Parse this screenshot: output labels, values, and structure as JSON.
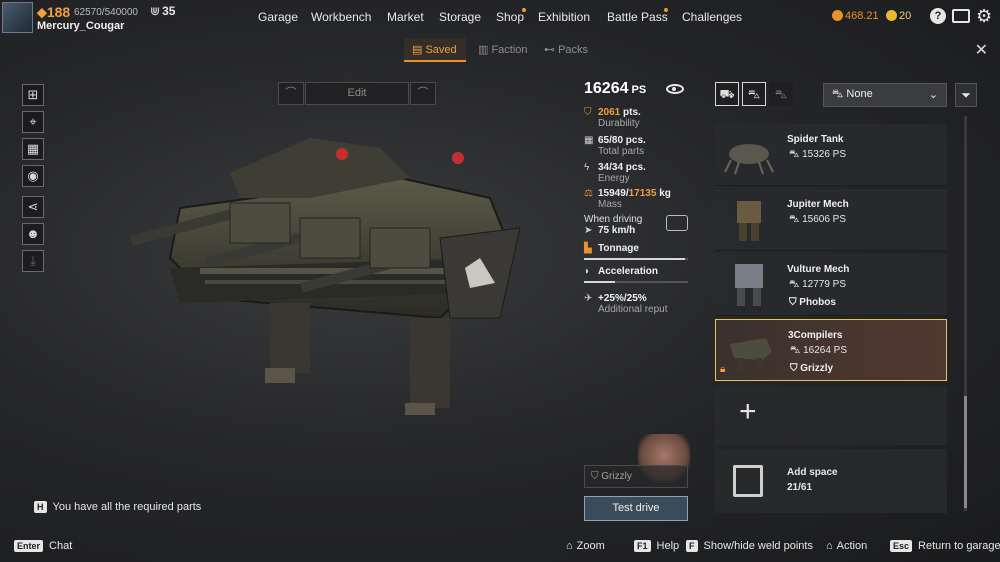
{
  "player": {
    "level": "188",
    "xp": "62570/540000",
    "rank": "35",
    "username": "Mercury_Cougar"
  },
  "nav": {
    "items": [
      "Garage",
      "Workbench",
      "Market",
      "Storage",
      "Shop",
      "Exhibition",
      "Battle Pass",
      "Challenges"
    ]
  },
  "currency": {
    "coins": "468.21",
    "coins_color": "#e8922e",
    "gold": "20",
    "gold_color": "#e8b830"
  },
  "top_icons": [
    "help-icon",
    "news-icon",
    "settings-icon"
  ],
  "subtabs": {
    "saved": "Saved",
    "faction": "Faction",
    "packs": "Packs"
  },
  "edit": {
    "label": "Edit"
  },
  "stats": {
    "ps_value": "16264",
    "ps_unit": "PS",
    "durability_value": "2061",
    "durability_unit": "pts.",
    "durability_label": "Durability",
    "parts_value": "65/80 pcs.",
    "parts_label": "Total parts",
    "energy_value": "34/34 pcs.",
    "energy_label": "Energy",
    "mass_current": "15949",
    "mass_max": "17135",
    "mass_unit": "kg",
    "mass_label": "Mass",
    "driving_label": "When driving",
    "speed_value": "75 km/h",
    "tonnage_label": "Tonnage",
    "tonnage_fraction": 0.97,
    "acceleration_label": "Acceleration",
    "acceleration_fraction": 0.3,
    "reput_value": "+25%/25%",
    "reput_label": "Additional reput"
  },
  "pilot": {
    "name": "Grizzly"
  },
  "test_drive": {
    "label": "Test drive"
  },
  "message": {
    "key": "H",
    "text": "You have all the required parts"
  },
  "panel": {
    "dropdown_value": "None",
    "cards": [
      {
        "name": "Spider Tank",
        "ps": "15326 PS",
        "pilot": ""
      },
      {
        "name": "Jupiter Mech",
        "ps": "15606 PS",
        "pilot": ""
      },
      {
        "name": "Vulture Mech",
        "ps": "12779 PS",
        "pilot": "Phobos"
      },
      {
        "name": "3Compilers",
        "ps": "16264 PS",
        "pilot": "Grizzly"
      }
    ],
    "add_space_label": "Add space",
    "add_space_count": "21/61"
  },
  "hints": {
    "chat_key": "Enter",
    "chat": "Chat",
    "zoom": "Zoom",
    "help_key": "F1",
    "help": "Help",
    "weld_key": "F",
    "weld": "Show/hide weld points",
    "action": "Action",
    "return_key": "Esc",
    "return": "Return to garage"
  },
  "colors": {
    "accent": "#e8922e",
    "selected_border": "#e8c060"
  }
}
